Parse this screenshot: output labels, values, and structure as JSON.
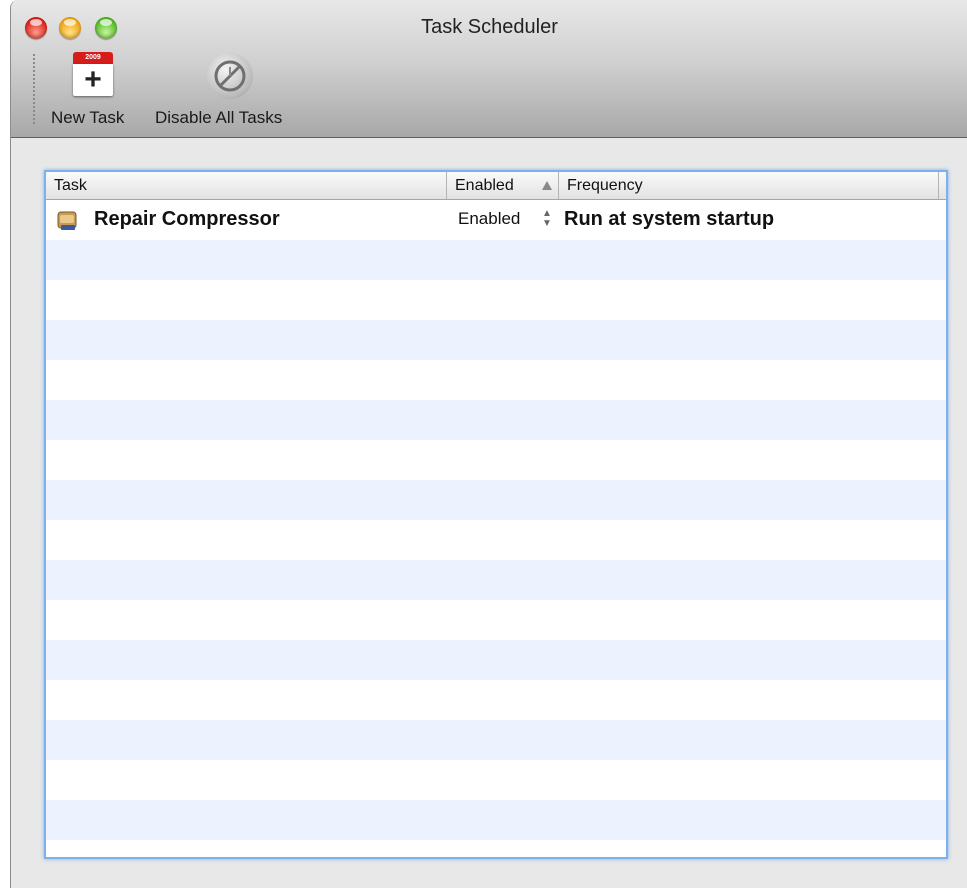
{
  "window": {
    "title": "Task Scheduler"
  },
  "toolbar": {
    "new_task": {
      "label": "New Task",
      "icon": "calendar-plus-icon",
      "calendar_year": "2009"
    },
    "disable_all": {
      "label": "Disable All Tasks",
      "icon": "disabled-clock-icon"
    }
  },
  "table": {
    "columns": [
      {
        "key": "task",
        "label": "Task"
      },
      {
        "key": "enabled",
        "label": "Enabled",
        "sorted": "ascending"
      },
      {
        "key": "frequency",
        "label": "Frequency"
      }
    ],
    "rows": [
      {
        "task": "Repair Compressor",
        "enabled": "Enabled",
        "frequency": "Run at system startup",
        "icon": "compressor-app-icon"
      }
    ]
  },
  "colors": {
    "selection_ring": "#7eb1ec",
    "row_stripe": "#edf3fe",
    "close": "#d81d12",
    "minimize": "#f0a10f",
    "zoom": "#4fb622"
  }
}
